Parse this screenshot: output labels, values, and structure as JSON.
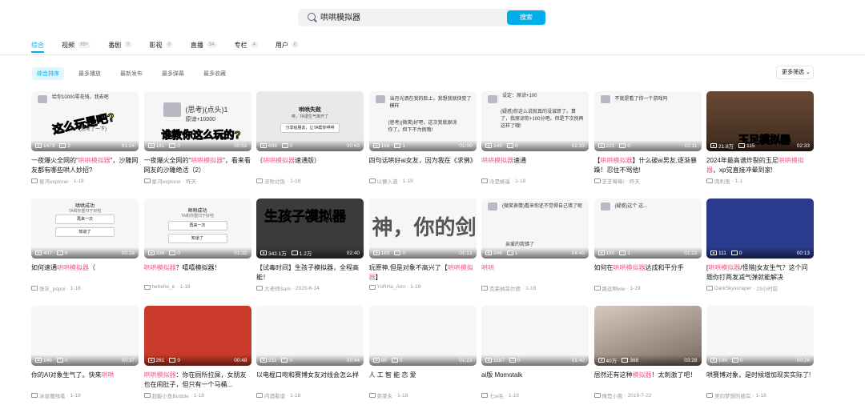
{
  "search": {
    "query": "哄哄模拟器",
    "button": "搜索"
  },
  "tabs": [
    {
      "label": "综合",
      "count": ""
    },
    {
      "label": "视频",
      "count": "99+"
    },
    {
      "label": "番剧",
      "count": "0"
    },
    {
      "label": "影视",
      "count": "0"
    },
    {
      "label": "直播",
      "count": "54"
    },
    {
      "label": "专栏",
      "count": "4"
    },
    {
      "label": "用户",
      "count": "0"
    }
  ],
  "sorts": [
    "综合排序",
    "最多播放",
    "最新发布",
    "最多弹幕",
    "最多收藏"
  ],
  "more_filter": "更多筛选",
  "videos": [
    {
      "views": "1473",
      "danmaku": "2",
      "duration": "01:24",
      "title_pre": "一夜爆火全网的“",
      "hl": "哄哄模拟器",
      "title_post": "”，沙雕网友都有哪些哄人妙招?",
      "author": "星河explorer",
      "date": "1-18"
    },
    {
      "views": "181",
      "danmaku": "0",
      "duration": "00:51",
      "title_pre": "一夜爆火全网的“",
      "hl": "哄哄模拟器",
      "title_post": "”，看来看网友的沙雕绝活（2）",
      "author": "星河explorer",
      "date": "昨天"
    },
    {
      "views": "699",
      "danmaku": "0",
      "duration": "00:43",
      "title_pre": "（",
      "hl": "哄哄模拟器",
      "title_post": "速通版）",
      "author": "没吹过饭",
      "date": "1-18"
    },
    {
      "views": "166",
      "danmaku": "1",
      "duration": "01:00",
      "title_pre": "四句话哄好ai女友，因为我在《求佛》",
      "hl": "",
      "title_post": "",
      "author": "以懒入道",
      "date": "1-19"
    },
    {
      "views": "149",
      "danmaku": "0",
      "duration": "02:33",
      "title_pre": "",
      "hl": "哄哄模拟器",
      "title_post": "速通",
      "author": "冷是嫉遥",
      "date": "1-18"
    },
    {
      "views": "221",
      "danmaku": "0",
      "duration": "02:11",
      "title_pre": "【",
      "hl": "哄哄模拟器",
      "title_post": "】什么破ai男友,逐渐暴躁！忍住不骂他!",
      "author": "芝芝莓莓r",
      "date": "昨天"
    },
    {
      "views": "21.8万",
      "danmaku": "115",
      "duration": "02:33",
      "title_pre": "2024年最高谱炸裂的玉足",
      "hl": "哄哄模拟器",
      "title_post": "，xp党直接冲晕到家!",
      "author": "肉利鬼",
      "date": "1-1"
    },
    {
      "views": "407",
      "danmaku": "0",
      "duration": "00:28",
      "title_pre": "如何速通",
      "hl": "哄哄模拟器",
      "title_post": "（",
      "author": "张灰_popoi",
      "date": "1-18"
    },
    {
      "views": "336",
      "danmaku": "0",
      "duration": "01:32",
      "title_pre": "",
      "hl": "哄哄模拟器",
      "title_post": "？嘻嘻模拟器！",
      "author": "hehehe_e",
      "date": "1-18"
    },
    {
      "views": "342.1万",
      "danmaku": "1.2万",
      "duration": "02:40",
      "title_pre": "【试毒时间】生孩子模拟器，全程高能！",
      "hl": "",
      "title_post": "",
      "author": "大老师Sam",
      "date": "2020-6-14"
    },
    {
      "views": "163",
      "danmaku": "0",
      "duration": "01:13",
      "title_pre": "玩原神,但是对象不高兴了【",
      "hl": "哄哄模拟器",
      "title_post": "】",
      "author": "YoRHa_Ann",
      "date": "1-19"
    },
    {
      "views": "246",
      "danmaku": "1",
      "duration": "04:45",
      "title_pre": "",
      "hl": "哄哄",
      "title_post": "",
      "author": "克莱纳菲尔德",
      "date": "1-18"
    },
    {
      "views": "180",
      "danmaku": "1",
      "duration": "01:22",
      "title_pre": "如何在",
      "hl": "哄哄模拟器",
      "title_post": "达成和平分手",
      "author": "路远啊ww",
      "date": "1-19"
    },
    {
      "views": "111",
      "danmaku": "0",
      "duration": "00:13",
      "title_pre": "[",
      "hl": "哄哄模拟器",
      "title_post": "/怪猎]女友生气？这个问题你打两发减气弹就能解决",
      "author": "DarkSkyscraper",
      "date": "23小时前"
    },
    {
      "views": "146",
      "danmaku": "0",
      "duration": "00:37",
      "title_pre": "你的AI对象生气了。快来",
      "hl": "哄哄",
      "title_post": "",
      "author": "冰音魔残笔",
      "date": "1-19"
    },
    {
      "views": "261",
      "danmaku": "0",
      "duration": "00:48",
      "title_pre": "",
      "hl": "哄哄模拟器",
      "title_post": "：你在厕所拉屎，女朋友也在闹肚子，但只有一个马桶...",
      "author": "超能小鱼Bubble",
      "date": "1-18"
    },
    {
      "views": "211",
      "danmaku": "0",
      "duration": "00:44",
      "title_pre": "以电棍口吻和赛博女友对线会怎么样",
      "hl": "",
      "title_post": "",
      "author": "内酒看谱",
      "date": "1-18"
    },
    {
      "views": "88",
      "danmaku": "0",
      "duration": "01:23",
      "title_pre": "人 工 智 能 恋 爱",
      "hl": "",
      "title_post": "",
      "author": "菜菜永",
      "date": "1-18"
    },
    {
      "views": "1187",
      "danmaku": "0",
      "duration": "01:42",
      "title_pre": "ai版 Momotalk",
      "hl": "",
      "title_post": "",
      "author": "七w毛",
      "date": "1-19"
    },
    {
      "views": "40万",
      "danmaku": "368",
      "duration": "03:28",
      "title_pre": "居然还有这种",
      "hl": "模拟器",
      "title_post": "！太刺激了吧！",
      "author": "俺是小熊",
      "date": "2019-7-22"
    },
    {
      "views": "199",
      "danmaku": "0",
      "duration": "00:26",
      "title_pre": "哄赛博对象，是时候增加现实实际了!",
      "hl": "",
      "title_post": "",
      "author": "美向梦想的彼岸",
      "date": "1-18"
    }
  ],
  "thumb_text": {
    "t1_top": "给你10000零花钱，我去吧",
    "t1_yellow": "这么玩是吧?",
    "t1_sub": "(思考了一下)",
    "t2_mid": "(思考)(点头)1",
    "t2_sub": "原谅+10000",
    "t2_yellow": "谁教你这么玩的?",
    "t3_title": "哄哄失败",
    "t3_sub": "唉，TA很生气离开了",
    "t3_btn": "分享给朋友，让TA帮你哄哄",
    "t4_top": "当月光洒在我的脸上，我想我就快变了模样",
    "t4_sub": "(思考)(微笑)好吧，这次我就原谅你了。但下不为例哦!",
    "t5_top": "设定：原谅+100",
    "t5_sub": "(疑惑)你这么说就真的没诚意了。算了，我原谅你+100分吧。但是下次别再这样了哦!",
    "t6_top": "不就是看了你一个游戏吗",
    "t7_yellow": "玉足模拟器",
    "t8_title": "哄哄成功",
    "t8_sub": "TA和你重归于好啦",
    "t8_btn1": "再来一次",
    "t8_btn2": "知道了",
    "t9_title": "哄哄成功",
    "t9_sub": "TA和你重归于好啦",
    "t9_btn1": "再来一次",
    "t9_btn2": "知道了",
    "t10_big": "生孩子模拟器",
    "t11_big": "神，你的剑",
    "t12_top": "(微笑表情)看来你还不觉得自己错了呢",
    "t12_sub": "亲爱的我错了",
    "t13_top": "(疑惑)这个  这..."
  },
  "rows": [
    "row1",
    "row2",
    "row3"
  ]
}
